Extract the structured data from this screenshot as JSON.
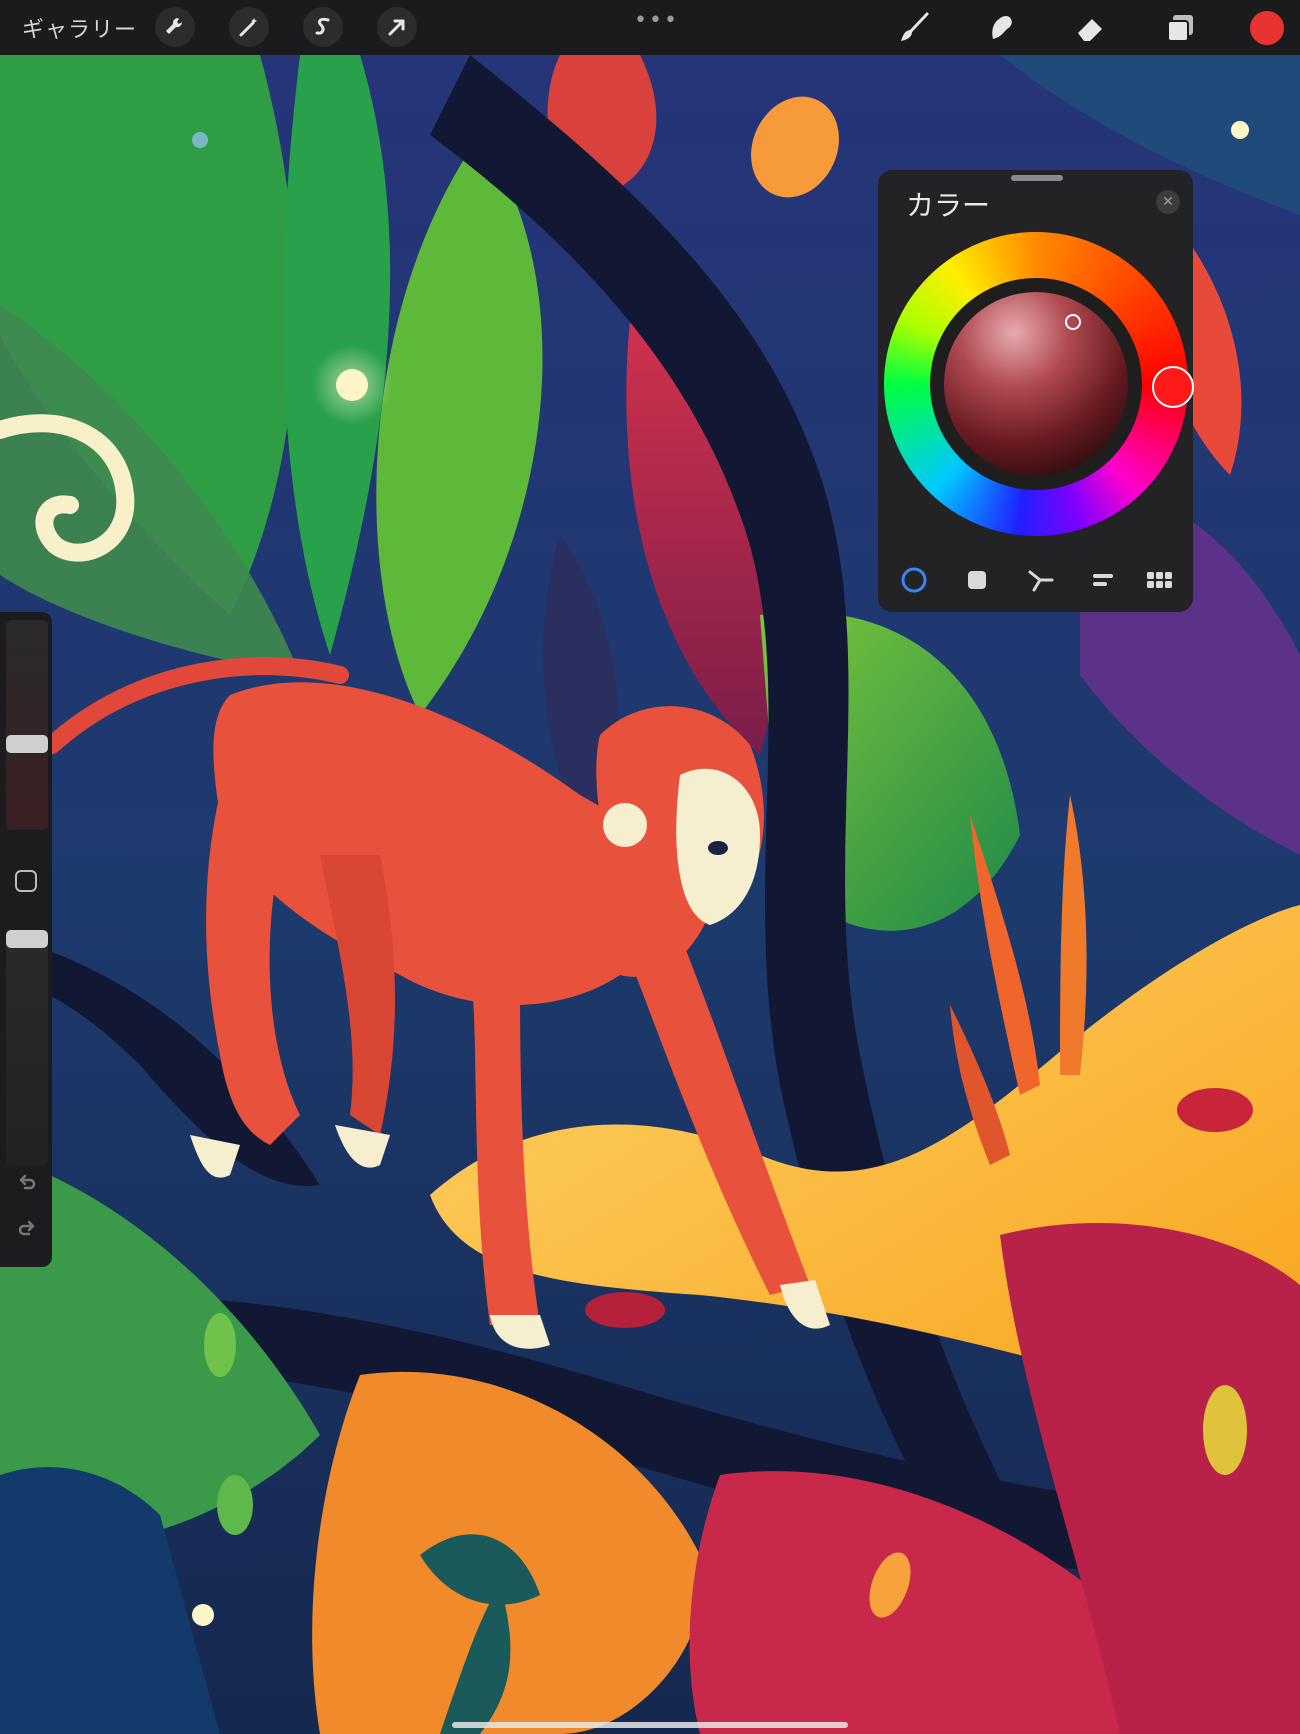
{
  "app": {
    "gallery_label": "ギャラリー",
    "more_label": "•••",
    "current_color": "#e8332f"
  },
  "toolbar_left": [
    {
      "name": "actions-wrench-icon"
    },
    {
      "name": "adjustments-magic-wand-icon"
    },
    {
      "name": "selection-s-icon"
    },
    {
      "name": "transform-arrow-icon"
    }
  ],
  "toolbar_right": [
    {
      "name": "brush-icon"
    },
    {
      "name": "smudge-icon"
    },
    {
      "name": "eraser-icon"
    },
    {
      "name": "layers-icon"
    }
  ],
  "color_panel": {
    "title": "カラー",
    "close_icon": "close-icon",
    "hue_color": "#ff1a1a",
    "tabs": [
      {
        "name": "disc-tab",
        "active": true
      },
      {
        "name": "classic-tab",
        "active": false
      },
      {
        "name": "harmony-tab",
        "active": false
      },
      {
        "name": "value-tab",
        "active": false
      },
      {
        "name": "palettes-tab",
        "active": false
      }
    ]
  },
  "sidebar": {
    "brush_size_level": 0.4,
    "opacity_level": 1.0,
    "undo_icon": "undo-icon",
    "redo_icon": "redo-icon"
  }
}
